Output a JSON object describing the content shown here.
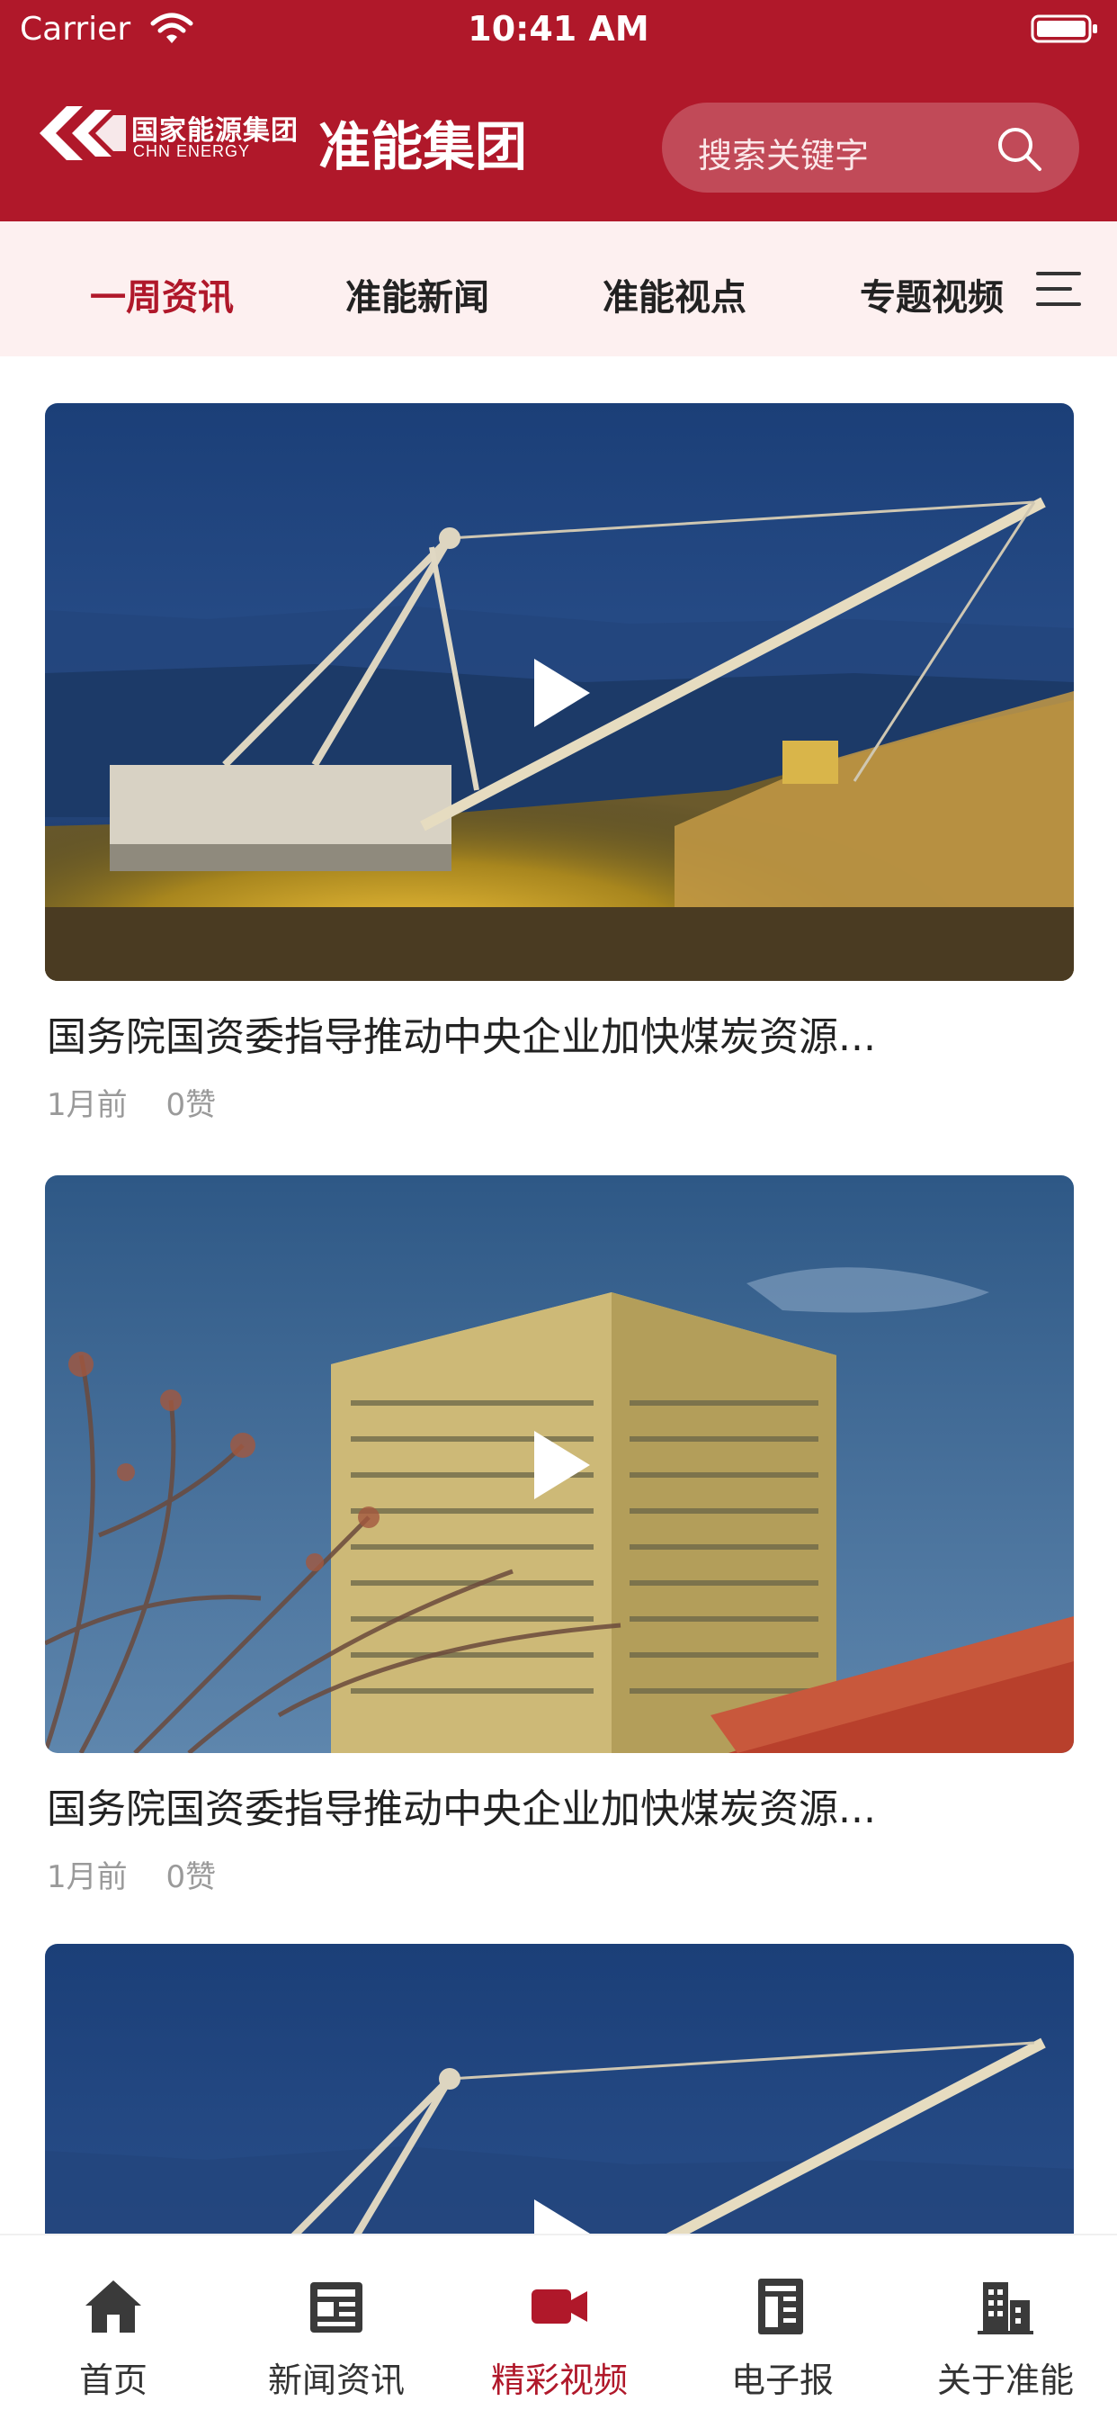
{
  "status_bar": {
    "carrier": "Carrier",
    "time": "10:41 AM"
  },
  "brand": {
    "logo_cn": "国家能源集团",
    "logo_en": "CHN ENERGY",
    "app_title": "准能集团"
  },
  "search": {
    "placeholder": "搜索关键字"
  },
  "tabs": [
    {
      "label": "一周资讯",
      "active": true
    },
    {
      "label": "准能新闻",
      "active": false
    },
    {
      "label": "准能视点",
      "active": false
    },
    {
      "label": "专题视频",
      "active": false
    }
  ],
  "feed": [
    {
      "title": "国务院国资委指导推动中央企业加快煤炭资源...",
      "time": "1月前",
      "likes": "0赞",
      "thumbnail": "excavator-night"
    },
    {
      "title": "国务院国资委指导推动中央企业加快煤炭资源...",
      "time": "1月前",
      "likes": "0赞",
      "thumbnail": "office-building"
    },
    {
      "title": "",
      "time": "",
      "likes": "",
      "thumbnail": "excavator-night"
    }
  ],
  "bottom_nav": [
    {
      "label": "首页",
      "icon": "home-icon",
      "active": false
    },
    {
      "label": "新闻资讯",
      "icon": "news-icon",
      "active": false
    },
    {
      "label": "精彩视频",
      "icon": "video-camera-icon",
      "active": true
    },
    {
      "label": "电子报",
      "icon": "newspaper-icon",
      "active": false
    },
    {
      "label": "关于准能",
      "icon": "building-icon",
      "active": false
    }
  ],
  "colors": {
    "brand_red": "#b0182a",
    "tab_bg": "#fdf0f0",
    "meta_gray": "#9a9a9a"
  }
}
